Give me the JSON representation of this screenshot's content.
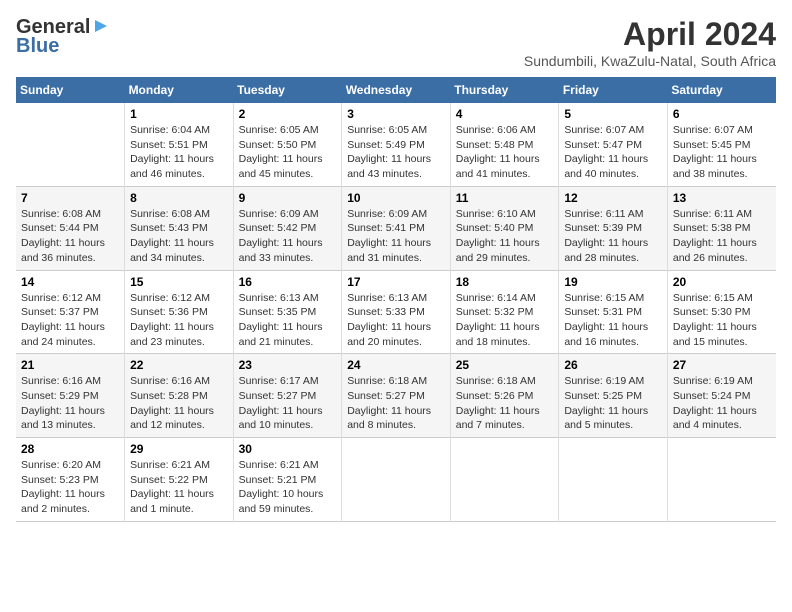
{
  "logo": {
    "line1": "General",
    "line2": "Blue"
  },
  "title": "April 2024",
  "subtitle": "Sundumbili, KwaZulu-Natal, South Africa",
  "days_of_week": [
    "Sunday",
    "Monday",
    "Tuesday",
    "Wednesday",
    "Thursday",
    "Friday",
    "Saturday"
  ],
  "weeks": [
    [
      {
        "day": "",
        "text": ""
      },
      {
        "day": "1",
        "text": "Sunrise: 6:04 AM\nSunset: 5:51 PM\nDaylight: 11 hours\nand 46 minutes."
      },
      {
        "day": "2",
        "text": "Sunrise: 6:05 AM\nSunset: 5:50 PM\nDaylight: 11 hours\nand 45 minutes."
      },
      {
        "day": "3",
        "text": "Sunrise: 6:05 AM\nSunset: 5:49 PM\nDaylight: 11 hours\nand 43 minutes."
      },
      {
        "day": "4",
        "text": "Sunrise: 6:06 AM\nSunset: 5:48 PM\nDaylight: 11 hours\nand 41 minutes."
      },
      {
        "day": "5",
        "text": "Sunrise: 6:07 AM\nSunset: 5:47 PM\nDaylight: 11 hours\nand 40 minutes."
      },
      {
        "day": "6",
        "text": "Sunrise: 6:07 AM\nSunset: 5:45 PM\nDaylight: 11 hours\nand 38 minutes."
      }
    ],
    [
      {
        "day": "7",
        "text": "Sunrise: 6:08 AM\nSunset: 5:44 PM\nDaylight: 11 hours\nand 36 minutes."
      },
      {
        "day": "8",
        "text": "Sunrise: 6:08 AM\nSunset: 5:43 PM\nDaylight: 11 hours\nand 34 minutes."
      },
      {
        "day": "9",
        "text": "Sunrise: 6:09 AM\nSunset: 5:42 PM\nDaylight: 11 hours\nand 33 minutes."
      },
      {
        "day": "10",
        "text": "Sunrise: 6:09 AM\nSunset: 5:41 PM\nDaylight: 11 hours\nand 31 minutes."
      },
      {
        "day": "11",
        "text": "Sunrise: 6:10 AM\nSunset: 5:40 PM\nDaylight: 11 hours\nand 29 minutes."
      },
      {
        "day": "12",
        "text": "Sunrise: 6:11 AM\nSunset: 5:39 PM\nDaylight: 11 hours\nand 28 minutes."
      },
      {
        "day": "13",
        "text": "Sunrise: 6:11 AM\nSunset: 5:38 PM\nDaylight: 11 hours\nand 26 minutes."
      }
    ],
    [
      {
        "day": "14",
        "text": "Sunrise: 6:12 AM\nSunset: 5:37 PM\nDaylight: 11 hours\nand 24 minutes."
      },
      {
        "day": "15",
        "text": "Sunrise: 6:12 AM\nSunset: 5:36 PM\nDaylight: 11 hours\nand 23 minutes."
      },
      {
        "day": "16",
        "text": "Sunrise: 6:13 AM\nSunset: 5:35 PM\nDaylight: 11 hours\nand 21 minutes."
      },
      {
        "day": "17",
        "text": "Sunrise: 6:13 AM\nSunset: 5:33 PM\nDaylight: 11 hours\nand 20 minutes."
      },
      {
        "day": "18",
        "text": "Sunrise: 6:14 AM\nSunset: 5:32 PM\nDaylight: 11 hours\nand 18 minutes."
      },
      {
        "day": "19",
        "text": "Sunrise: 6:15 AM\nSunset: 5:31 PM\nDaylight: 11 hours\nand 16 minutes."
      },
      {
        "day": "20",
        "text": "Sunrise: 6:15 AM\nSunset: 5:30 PM\nDaylight: 11 hours\nand 15 minutes."
      }
    ],
    [
      {
        "day": "21",
        "text": "Sunrise: 6:16 AM\nSunset: 5:29 PM\nDaylight: 11 hours\nand 13 minutes."
      },
      {
        "day": "22",
        "text": "Sunrise: 6:16 AM\nSunset: 5:28 PM\nDaylight: 11 hours\nand 12 minutes."
      },
      {
        "day": "23",
        "text": "Sunrise: 6:17 AM\nSunset: 5:27 PM\nDaylight: 11 hours\nand 10 minutes."
      },
      {
        "day": "24",
        "text": "Sunrise: 6:18 AM\nSunset: 5:27 PM\nDaylight: 11 hours\nand 8 minutes."
      },
      {
        "day": "25",
        "text": "Sunrise: 6:18 AM\nSunset: 5:26 PM\nDaylight: 11 hours\nand 7 minutes."
      },
      {
        "day": "26",
        "text": "Sunrise: 6:19 AM\nSunset: 5:25 PM\nDaylight: 11 hours\nand 5 minutes."
      },
      {
        "day": "27",
        "text": "Sunrise: 6:19 AM\nSunset: 5:24 PM\nDaylight: 11 hours\nand 4 minutes."
      }
    ],
    [
      {
        "day": "28",
        "text": "Sunrise: 6:20 AM\nSunset: 5:23 PM\nDaylight: 11 hours\nand 2 minutes."
      },
      {
        "day": "29",
        "text": "Sunrise: 6:21 AM\nSunset: 5:22 PM\nDaylight: 11 hours\nand 1 minute."
      },
      {
        "day": "30",
        "text": "Sunrise: 6:21 AM\nSunset: 5:21 PM\nDaylight: 10 hours\nand 59 minutes."
      },
      {
        "day": "",
        "text": ""
      },
      {
        "day": "",
        "text": ""
      },
      {
        "day": "",
        "text": ""
      },
      {
        "day": "",
        "text": ""
      }
    ]
  ]
}
